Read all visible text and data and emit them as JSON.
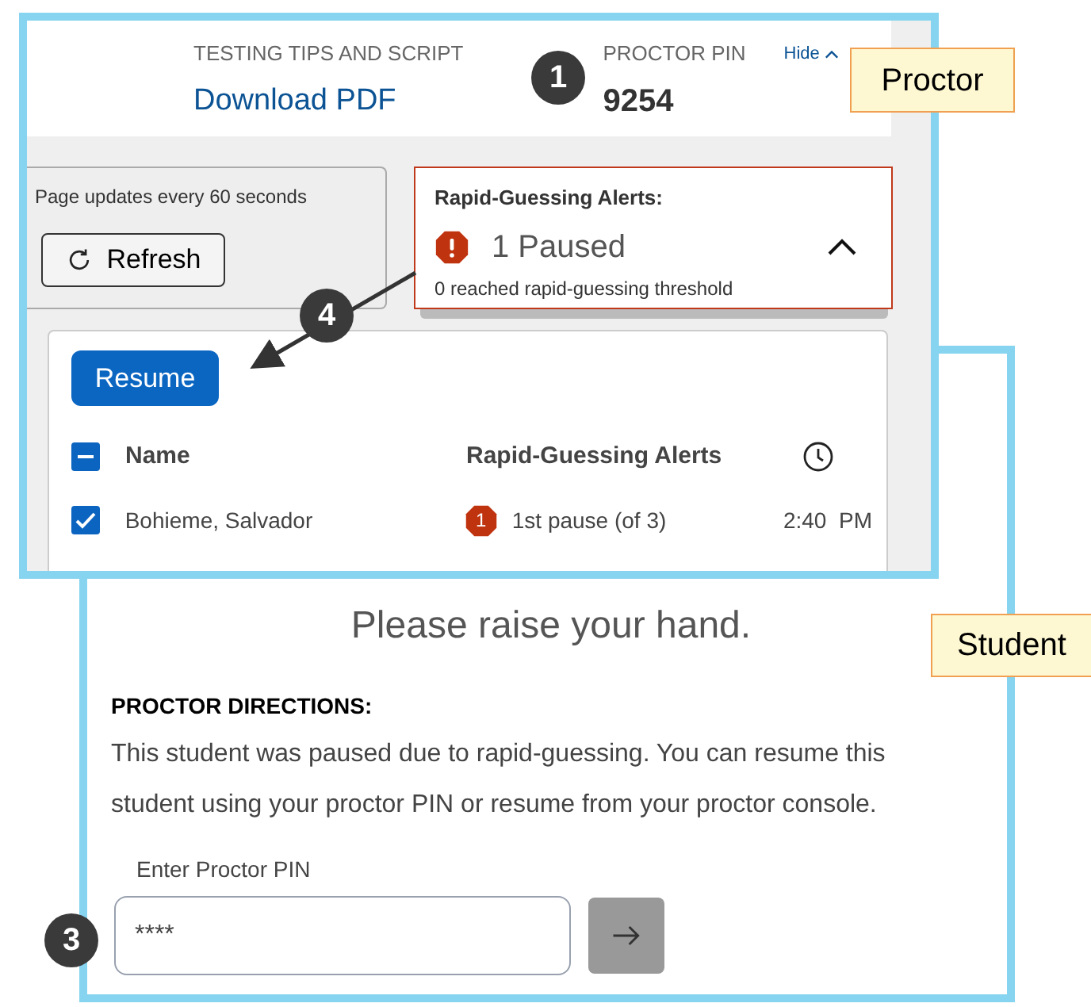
{
  "proctor_screen": {
    "label": "Proctor",
    "header": {
      "tips_label": "TESTING TIPS AND SCRIPT",
      "download_link": "Download PDF",
      "pin_label": "PROCTOR PIN",
      "pin": "9254",
      "hide_link": "Hide"
    },
    "refresh_panel": {
      "note": "Page updates every 60 seconds",
      "button": "Refresh"
    },
    "alert_panel": {
      "title": "Rapid-Guessing Alerts:",
      "count": "1 Paused",
      "subtitle": "0 reached rapid-guessing threshold",
      "expanded": true
    },
    "table": {
      "action_button": "Resume",
      "select_all": {
        "checked": true,
        "partial": true
      },
      "columns": [
        {
          "kind": "text",
          "label": "Name"
        },
        {
          "kind": "text",
          "label": "Rapid-Guessing Alerts"
        },
        {
          "kind": "clock"
        }
      ],
      "rows": [
        {
          "selected": true,
          "name": "Bohieme, Salvador",
          "alert_count": "1",
          "alert": "1st pause (of 3)",
          "time": "2:40  PM"
        }
      ]
    }
  },
  "student_screen": {
    "label": "Student",
    "heading": "Please raise your hand.",
    "directions_title": "PROCTOR DIRECTIONS:",
    "directions": "This student was paused due to rapid-guessing. You can resume this student using your proctor PIN or resume from your proctor console.",
    "pin_field": {
      "label": "Enter Proctor PIN",
      "value": "****"
    }
  },
  "callouts": [
    {
      "number": "1"
    },
    {
      "number": "4"
    },
    {
      "number": "3"
    }
  ]
}
